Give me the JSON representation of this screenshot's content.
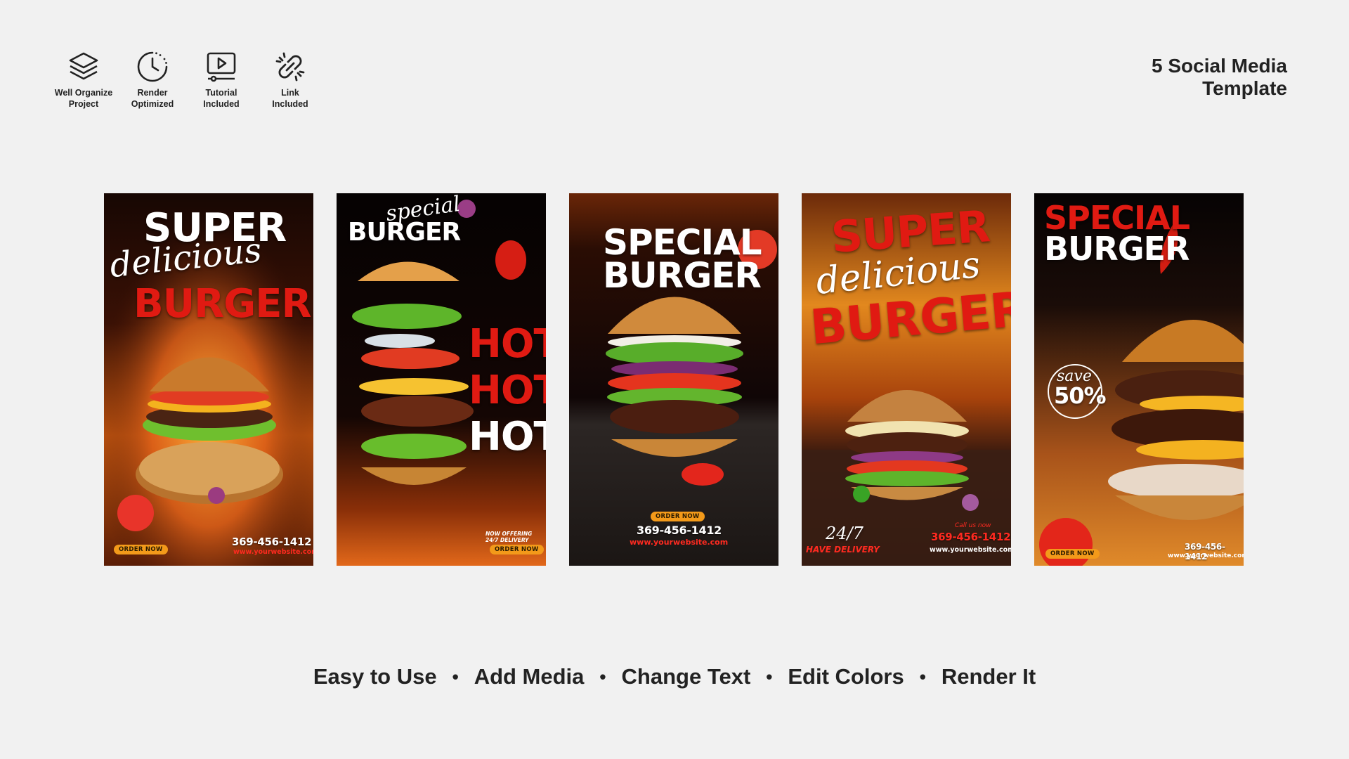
{
  "features": [
    {
      "icon": "layers-icon",
      "label": "Well Organize\nProject"
    },
    {
      "icon": "render-clock-icon",
      "label": "Render\nOptimized"
    },
    {
      "icon": "video-play-icon",
      "label": "Tutorial\nIncluded"
    },
    {
      "icon": "link-icon",
      "label": "Link\nIncluded"
    }
  ],
  "header": {
    "title_line1": "5 Social Media",
    "title_line2": "Template"
  },
  "templates": [
    {
      "line1": "SUPER",
      "script": "delicious",
      "line2": "BURGER",
      "order": "ORDER NOW",
      "phone": "369-456-1412",
      "website": "www.yourwebsite.com"
    },
    {
      "script": "special",
      "line1": "BURGER",
      "hot": [
        "HOT!",
        "HOT!",
        "HOT!"
      ],
      "offer": "NOW OFFERING\n24/7 DELIVERY",
      "order": "ORDER NOW"
    },
    {
      "line1": "SPECIAL",
      "line2": "BURGER",
      "order": "ORDER NOW",
      "phone": "369-456-1412",
      "website": "www.yourwebsite.com"
    },
    {
      "line1": "SUPER",
      "script": "delicious",
      "line2": "BURGER",
      "hours": "24/7",
      "delivery": "HAVE DELIVERY",
      "call": "Call us now",
      "phone": "369-456-1412",
      "website": "www.yourwebsite.com"
    },
    {
      "line1": "SPECIAL",
      "line2": "BURGER",
      "save_script": "save",
      "save_value": "50%",
      "order": "ORDER NOW",
      "phone": "369-456-1412",
      "website": "www.yourwebsite.com"
    }
  ],
  "steps": [
    "Easy to Use",
    "Add Media",
    "Change Text",
    "Edit Colors",
    "Render It"
  ],
  "colors": {
    "background": "#f1f1f1",
    "accent_red": "#e01a12",
    "accent_orange": "#f39a1a",
    "text_dark": "#222222"
  }
}
